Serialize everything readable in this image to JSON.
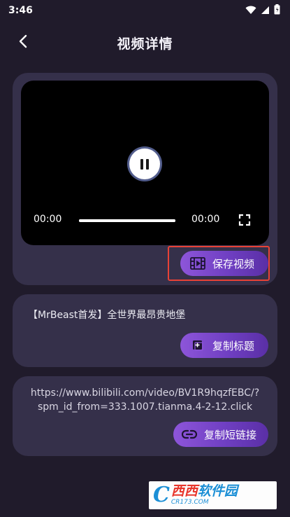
{
  "status_bar": {
    "time": "3:46",
    "icons": [
      "wifi-icon",
      "signal-icon",
      "battery-icon"
    ]
  },
  "header": {
    "back_icon": "chevron-left-icon",
    "title": "视频详情"
  },
  "player": {
    "current_time": "00:00",
    "total_time": "00:00",
    "progress": 1.0,
    "state_icon": "pause-icon",
    "fullscreen_icon": "fullscreen-icon"
  },
  "actions": {
    "save_video_label": "保存视频",
    "save_video_icon": "film-icon",
    "copy_title_label": "复制标题",
    "copy_title_icon": "add-copy-icon",
    "copy_link_label": "复制短链接",
    "copy_link_icon": "link-icon"
  },
  "video": {
    "title": "【MrBeast首发】全世界最昂贵地堡",
    "url": "https://www.bilibili.com/video/BV1R9hqzfEBC/?spm_id_from=333.1007.tianma.4-2-12.click"
  },
  "watermark": {
    "logo_letter": "C",
    "brand_left": "西西",
    "brand_right": "软件园",
    "domain": "CR173.COM"
  },
  "colors": {
    "background": "#201b2b",
    "card": "#35304a",
    "accent_start": "#8d55d9",
    "accent_end": "#5a2fa6",
    "highlight": "#e84236"
  }
}
